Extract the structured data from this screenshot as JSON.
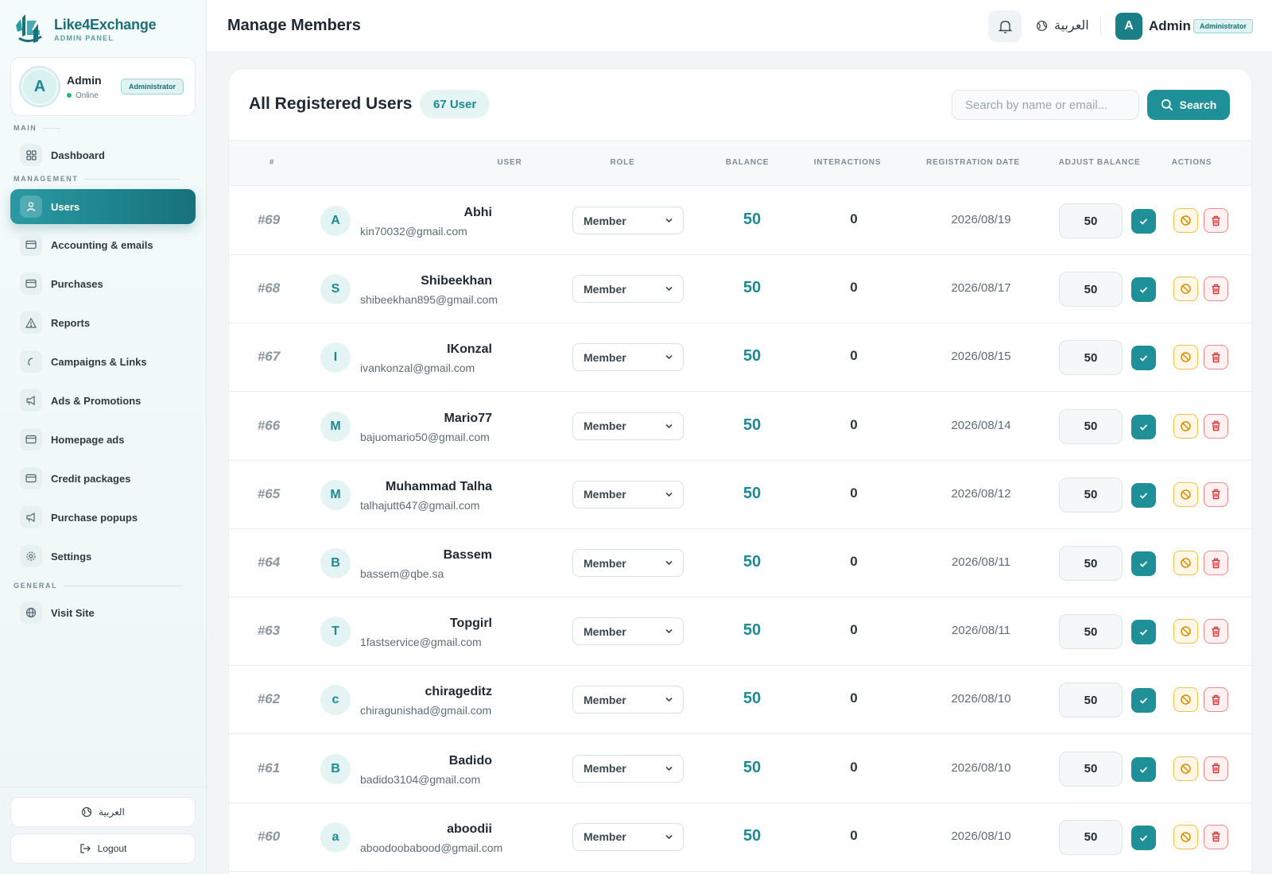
{
  "brand": {
    "name": "Like4Exchange",
    "subtitle": "ADMIN PANEL"
  },
  "sidebar": {
    "profile": {
      "initial": "A",
      "name": "Admin",
      "status": "Online",
      "role": "Administrator"
    },
    "sections": {
      "main": "MAIN",
      "management": "MANAGEMENT",
      "general": "GENERAL"
    },
    "items": [
      {
        "label": "Dashboard",
        "icon": "grid-icon"
      },
      {
        "label": "Users",
        "icon": "users-icon",
        "active": true
      },
      {
        "label": "Accounting & emails",
        "icon": "card-icon"
      },
      {
        "label": "Purchases",
        "icon": "card-icon"
      },
      {
        "label": "Reports",
        "icon": "warning-icon"
      },
      {
        "label": "Campaigns & Links",
        "icon": "link-icon"
      },
      {
        "label": "Ads & Promotions",
        "icon": "megaphone-icon"
      },
      {
        "label": "Homepage ads",
        "icon": "card-icon"
      },
      {
        "label": "Credit packages",
        "icon": "card-icon"
      },
      {
        "label": "Purchase popups",
        "icon": "megaphone-icon"
      },
      {
        "label": "Settings",
        "icon": "gear-icon"
      },
      {
        "label": "Visit Site",
        "icon": "globe-icon"
      }
    ],
    "language_button": "العربية",
    "logout_button": "Logout"
  },
  "header": {
    "title": "Manage Members",
    "language": "العربية",
    "user_initial": "A",
    "user_name": "Admin",
    "user_role": "Administrator"
  },
  "main": {
    "title": "All Registered Users",
    "count": "67 User",
    "search_placeholder": "Search by name or email...",
    "search_button": "Search",
    "columns": [
      "#",
      "USER",
      "ROLE",
      "BALANCE",
      "INTERACTIONS",
      "REGISTRATION DATE",
      "ADJUST BALANCE",
      "ACTIONS"
    ],
    "rows": [
      {
        "id": "#69",
        "initial": "A",
        "name": "Abhi",
        "email": "kin70032@gmail.com",
        "role": "Member",
        "balance": "50",
        "interactions": "0",
        "date": "2026/08/19",
        "adjust": "50"
      },
      {
        "id": "#68",
        "initial": "S",
        "name": "Shibeekhan",
        "email": "shibeekhan895@gmail.com",
        "role": "Member",
        "balance": "50",
        "interactions": "0",
        "date": "2026/08/17",
        "adjust": "50"
      },
      {
        "id": "#67",
        "initial": "I",
        "name": "IKonzal",
        "email": "ivankonzal@gmail.com",
        "role": "Member",
        "balance": "50",
        "interactions": "0",
        "date": "2026/08/15",
        "adjust": "50"
      },
      {
        "id": "#66",
        "initial": "M",
        "name": "Mario77",
        "email": "bajuomario50@gmail.com",
        "role": "Member",
        "balance": "50",
        "interactions": "0",
        "date": "2026/08/14",
        "adjust": "50"
      },
      {
        "id": "#65",
        "initial": "M",
        "name": "Muhammad Talha",
        "email": "talhajutt647@gmail.com",
        "role": "Member",
        "balance": "50",
        "interactions": "0",
        "date": "2026/08/12",
        "adjust": "50"
      },
      {
        "id": "#64",
        "initial": "B",
        "name": "Bassem",
        "email": "bassem@qbe.sa",
        "role": "Member",
        "balance": "50",
        "interactions": "0",
        "date": "2026/08/11",
        "adjust": "50"
      },
      {
        "id": "#63",
        "initial": "T",
        "name": "Topgirl",
        "email": "1fastservice@gmail.com",
        "role": "Member",
        "balance": "50",
        "interactions": "0",
        "date": "2026/08/11",
        "adjust": "50"
      },
      {
        "id": "#62",
        "initial": "c",
        "name": "chirageditz",
        "email": "chiragunishad@gmail.com",
        "role": "Member",
        "balance": "50",
        "interactions": "0",
        "date": "2026/08/10",
        "adjust": "50"
      },
      {
        "id": "#61",
        "initial": "B",
        "name": "Badido",
        "email": "badido3104@gmail.com",
        "role": "Member",
        "balance": "50",
        "interactions": "0",
        "date": "2026/08/10",
        "adjust": "50"
      },
      {
        "id": "#60",
        "initial": "a",
        "name": "aboodii",
        "email": "aboodoobabood@gmail.com",
        "role": "Member",
        "balance": "50",
        "interactions": "0",
        "date": "2026/08/10",
        "adjust": "50"
      }
    ]
  },
  "colors": {
    "accent": "#1f8f98",
    "accent_dark": "#16717b",
    "warning": "#f3c14a",
    "danger": "#e25555",
    "online": "#22b573"
  }
}
